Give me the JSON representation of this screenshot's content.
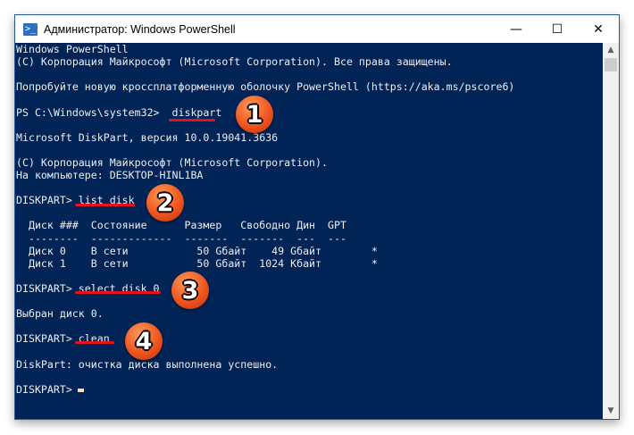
{
  "window": {
    "title": "Администратор: Windows PowerShell",
    "icon": "powershell-icon",
    "minimize": "—",
    "maximize": "☐",
    "close": "✕"
  },
  "console": {
    "lines": [
      "Windows PowerShell",
      "(C) Корпорация Майкрософт (Microsoft Corporation). Все права защищены.",
      "",
      "Попробуйте новую кроссплатформенную оболочку PowerShell (https://aka.ms/pscore6)",
      "",
      "PS C:\\Windows\\system32>  diskpart",
      "",
      "Microsoft DiskPart, версия 10.0.19041.3636",
      "",
      "(C) Корпорация Майкрософт (Microsoft Corporation).",
      "На компьютере: DESKTOP-HINL1BA",
      "",
      "DISKPART> list disk",
      "",
      "  Диск ###  Состояние      Размер   Свободно Дин  GPT",
      "  --------  -------------  -------  -------  ---  ---",
      "  Диск 0    В сети           50 Gбайт    49 Gбайт        *",
      "  Диск 1    В сети           50 Gбайт  1024 Kбайт        *",
      "",
      "DISKPART> select disk 0",
      "",
      "Выбран диск 0.",
      "",
      "DISKPART> clean",
      "",
      "DiskPart: очистка диска выполнена успешно.",
      "",
      "DISKPART> "
    ]
  },
  "annotations": [
    "1",
    "2",
    "3",
    "4"
  ],
  "colors": {
    "background": "#012456",
    "text": "#eeedf0",
    "underline": "#e8101b",
    "badge": "#f0551e"
  }
}
